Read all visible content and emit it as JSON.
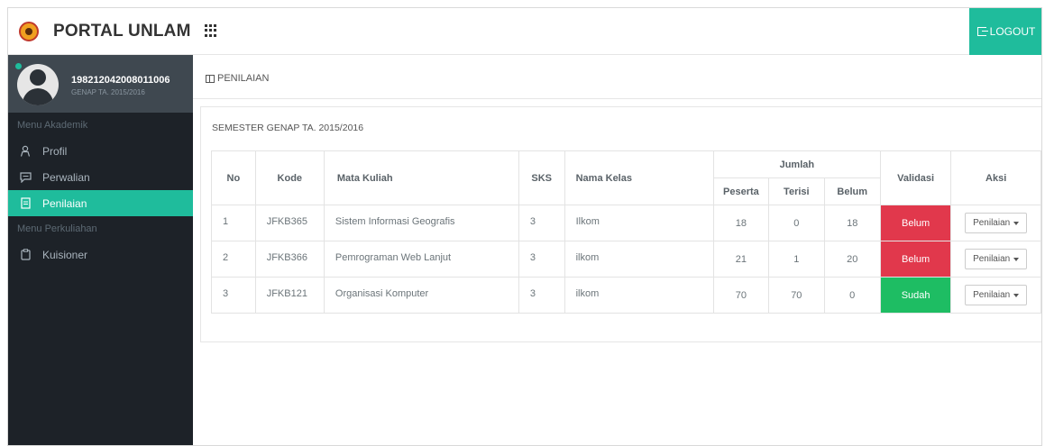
{
  "brand": {
    "title": "PORTAL UNLAM"
  },
  "header": {
    "logout_label": "LOGOUT"
  },
  "user": {
    "id": "198212042008011006",
    "semester": "GENAP TA. 2015/2016"
  },
  "sidebar": {
    "section_akademik": "Menu Akademik",
    "section_perkuliahan": "Menu Perkuliahan",
    "items": [
      {
        "label": "Profil",
        "icon": "user-icon"
      },
      {
        "label": "Perwalian",
        "icon": "chat-icon"
      },
      {
        "label": "Penilaian",
        "icon": "document-icon",
        "active": true
      },
      {
        "label": "Kuisioner",
        "icon": "clipboard-icon"
      }
    ]
  },
  "breadcrumb": {
    "label": "PENILAIAN"
  },
  "panel": {
    "title": "SEMESTER GENAP TA. 2015/2016"
  },
  "table": {
    "headers": {
      "no": "No",
      "kode": "Kode",
      "mata_kuliah": "Mata Kuliah",
      "sks": "SKS",
      "nama_kelas": "Nama Kelas",
      "jumlah": "Jumlah",
      "peserta": "Peserta",
      "terisi": "Terisi",
      "belum": "Belum",
      "validasi": "Validasi",
      "aksi": "Aksi"
    },
    "rows": [
      {
        "no": "1",
        "kode": "JFKB365",
        "mata_kuliah": "Sistem Informasi Geografis",
        "sks": "3",
        "nama_kelas": "Ilkom",
        "peserta": "18",
        "terisi": "0",
        "belum": "18",
        "validasi": "Belum",
        "aksi": "Penilaian"
      },
      {
        "no": "2",
        "kode": "JFKB366",
        "mata_kuliah": "Pemrograman Web Lanjut",
        "sks": "3",
        "nama_kelas": "ilkom",
        "peserta": "21",
        "terisi": "1",
        "belum": "20",
        "validasi": "Belum",
        "aksi": "Penilaian"
      },
      {
        "no": "3",
        "kode": "JFKB121",
        "mata_kuliah": "Organisasi Komputer",
        "sks": "3",
        "nama_kelas": "ilkom",
        "peserta": "70",
        "terisi": "70",
        "belum": "0",
        "validasi": "Sudah",
        "aksi": "Penilaian"
      }
    ]
  },
  "colors": {
    "accent": "#1fbc9c",
    "sidebar_bg": "#1d2228",
    "belum": "#e1384c",
    "sudah": "#1ebd63"
  }
}
